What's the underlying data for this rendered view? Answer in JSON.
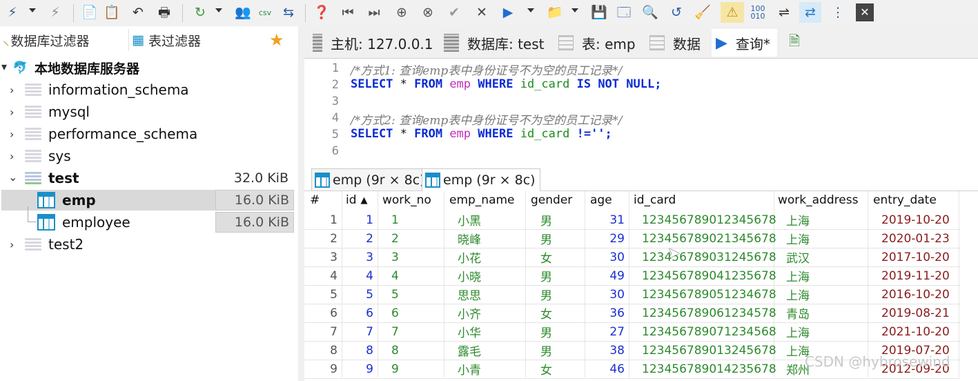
{
  "filters": {
    "db_filter": "数据库过滤器",
    "table_filter": "表过滤器"
  },
  "tree": {
    "root": "本地数据库服务器",
    "databases": [
      {
        "name": "information_schema"
      },
      {
        "name": "mysql"
      },
      {
        "name": "performance_schema"
      },
      {
        "name": "sys"
      },
      {
        "name": "test",
        "size": "32.0 KiB",
        "tables": [
          {
            "name": "emp",
            "size": "16.0 KiB"
          },
          {
            "name": "employee",
            "size": "16.0 KiB"
          }
        ]
      },
      {
        "name": "test2"
      }
    ]
  },
  "tabs": {
    "host": "主机: 127.0.0.1",
    "database": "数据库: test",
    "table": "表: emp",
    "data": "数据",
    "query": "查询*"
  },
  "editor": {
    "lines": [
      "1",
      "2",
      "3",
      "4",
      "5",
      "6"
    ],
    "comment1": "/*方式1: 查询emp表中身份证号不为空的员工记录*/",
    "comment2": "/*方式2: 查询emp表中身份证号不为空的员工记录*/",
    "sql1": {
      "select": "SELECT",
      "star": " * ",
      "from": "FROM",
      "table": " emp ",
      "where": "WHERE",
      "col": " id_card ",
      "is": "IS",
      "not": " NOT ",
      "null": "NULL",
      "end": ";"
    },
    "sql2": {
      "select": "SELECT",
      "star": " * ",
      "from": "FROM",
      "table": " emp ",
      "where": "WHERE",
      "col": " id_card ",
      "op": "!='';"
    }
  },
  "result_tabs": [
    "emp (9r × 8c)",
    "emp (9r × 8c)"
  ],
  "columns": [
    "#",
    "id",
    "work_no",
    "emp_name",
    "gender",
    "age",
    "id_card",
    "work_address",
    "entry_date"
  ],
  "rows": [
    {
      "n": "1",
      "id": "1",
      "work_no": "1",
      "emp_name": "小黑",
      "gender": "男",
      "age": "31",
      "id_card": "123456789012345678",
      "work_address": "上海",
      "entry_date": "2019-10-20"
    },
    {
      "n": "2",
      "id": "2",
      "work_no": "2",
      "emp_name": "晓峰",
      "gender": "男",
      "age": "29",
      "id_card": "123456789021345678",
      "work_address": "上海",
      "entry_date": "2020-01-23"
    },
    {
      "n": "3",
      "id": "3",
      "work_no": "3",
      "emp_name": "小花",
      "gender": "女",
      "age": "30",
      "id_card": "123456789031245678",
      "work_address": "武汉",
      "entry_date": "2017-10-20"
    },
    {
      "n": "4",
      "id": "4",
      "work_no": "4",
      "emp_name": "小晓",
      "gender": "男",
      "age": "49",
      "id_card": "123456789041235678",
      "work_address": "上海",
      "entry_date": "2019-11-20"
    },
    {
      "n": "5",
      "id": "5",
      "work_no": "5",
      "emp_name": "思思",
      "gender": "男",
      "age": "30",
      "id_card": "123456789051234678",
      "work_address": "上海",
      "entry_date": "2016-10-20"
    },
    {
      "n": "6",
      "id": "6",
      "work_no": "6",
      "emp_name": "小齐",
      "gender": "女",
      "age": "36",
      "id_card": "123456789061234578",
      "work_address": "青岛",
      "entry_date": "2019-08-21"
    },
    {
      "n": "7",
      "id": "7",
      "work_no": "7",
      "emp_name": "小华",
      "gender": "男",
      "age": "27",
      "id_card": "123456789071234568",
      "work_address": "上海",
      "entry_date": "2021-10-20"
    },
    {
      "n": "8",
      "id": "8",
      "work_no": "8",
      "emp_name": "露毛",
      "gender": "男",
      "age": "38",
      "id_card": "123456789013245678",
      "work_address": "上海",
      "entry_date": "2019-07-20"
    },
    {
      "n": "9",
      "id": "9",
      "work_no": "9",
      "emp_name": "小青",
      "gender": "女",
      "age": "46",
      "id_card": "123456789014235678",
      "work_address": "郑州",
      "entry_date": "2012-09-20"
    }
  ],
  "watermark": "CSDN @hybrosewind",
  "colors": {
    "keyword": "#0a2bd6",
    "table_token": "#c02fb8",
    "identifier": "#1c8c1c",
    "selection": "#d9d9d9",
    "table_icon": "#1a8fc8"
  }
}
